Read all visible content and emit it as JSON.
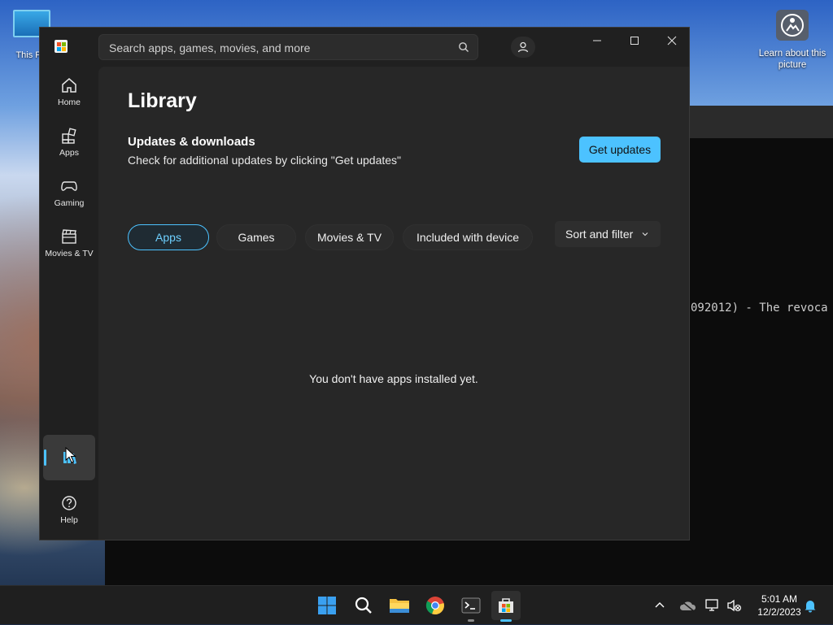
{
  "desktop": {
    "this_pc_label": "This PC",
    "learn_label": "Learn about this picture"
  },
  "terminal": {
    "visible_text": "092012) - The revoca"
  },
  "store": {
    "search": {
      "placeholder": "Search apps, games, movies, and more"
    },
    "sidebar": {
      "items": [
        {
          "label": "Home",
          "icon": "home-icon"
        },
        {
          "label": "Apps",
          "icon": "apps-icon"
        },
        {
          "label": "Gaming",
          "icon": "gaming-icon"
        },
        {
          "label": "Movies & TV",
          "icon": "movies-icon"
        },
        {
          "label": "",
          "icon": "library-icon",
          "active": true
        },
        {
          "label": "Help",
          "icon": "help-icon"
        }
      ]
    },
    "page_title": "Library",
    "updates": {
      "title": "Updates & downloads",
      "description": "Check for additional updates by clicking \"Get updates\"",
      "button_label": "Get updates"
    },
    "filters": [
      {
        "label": "Apps",
        "selected": true
      },
      {
        "label": "Games",
        "selected": false
      },
      {
        "label": "Movies & TV",
        "selected": false
      },
      {
        "label": "Included with device",
        "selected": false
      }
    ],
    "sort_label": "Sort and filter",
    "empty_message": "You don't have apps installed yet."
  },
  "taskbar": {
    "apps": [
      "start-icon",
      "search-icon",
      "file-explorer-icon",
      "chrome-icon",
      "terminal-icon",
      "store-icon"
    ],
    "time": "5:01 AM",
    "date": "12/2/2023"
  },
  "colors": {
    "accent": "#4cc2ff",
    "window_bg": "#202020",
    "content_bg": "#272727"
  }
}
